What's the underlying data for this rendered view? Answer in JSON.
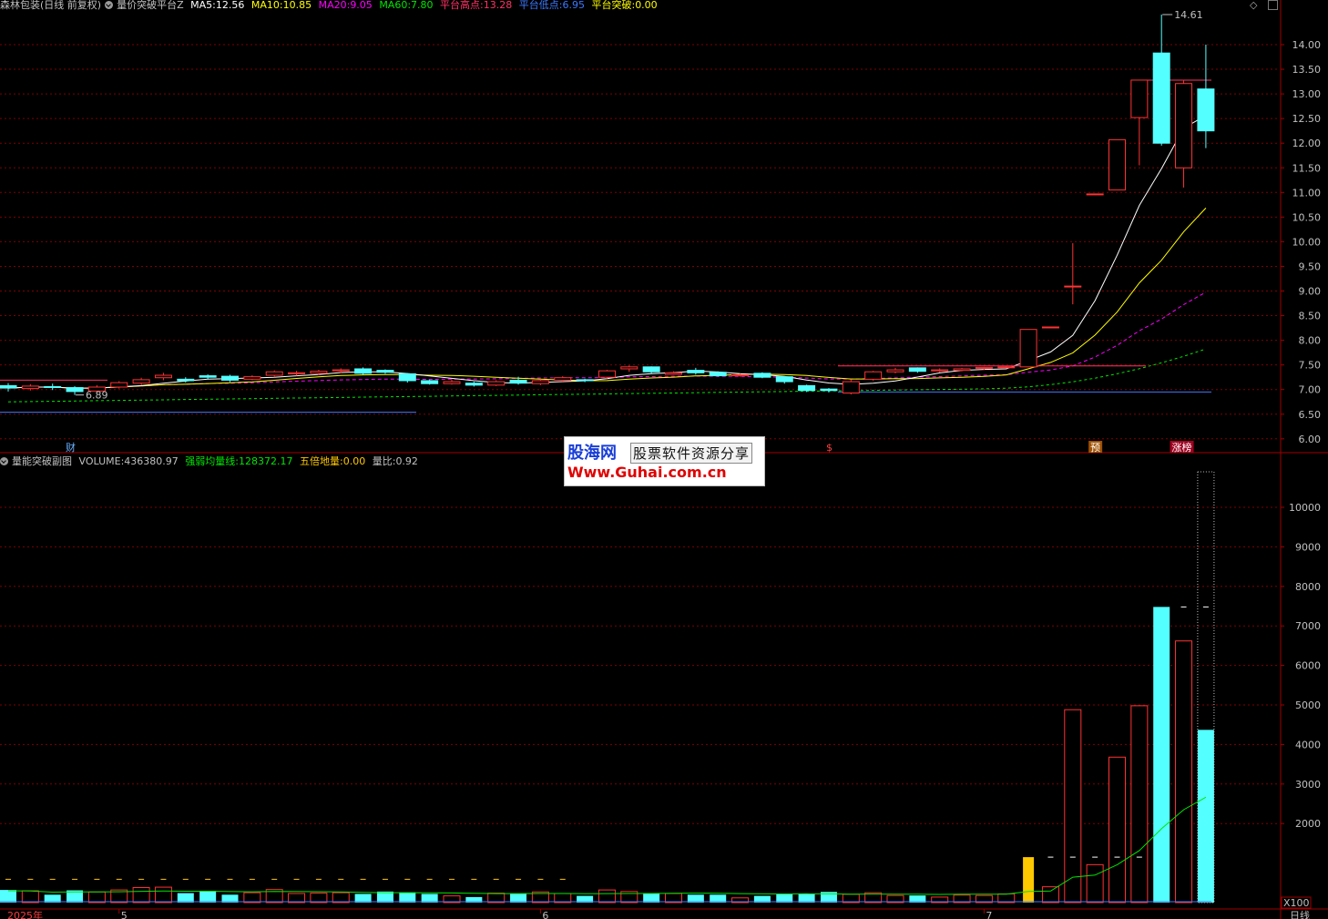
{
  "header": {
    "stock": "森林包装(日线 前复权)",
    "indicator": "量价突破平台Z",
    "ma5_label": "MA5:",
    "ma5": "12.56",
    "ma10_label": "MA10:",
    "ma10": "10.85",
    "ma20_label": "MA20:",
    "ma20": "9.05",
    "ma60_label": "MA60:",
    "ma60": "7.80",
    "high_label": "平台高点:",
    "high": "13.28",
    "low_label": "平台低点:",
    "low": "6.95",
    "break_label": "平台突破:",
    "break": "0.00"
  },
  "sub": {
    "indicator": "量能突破副图",
    "vol_label": "VOLUME:",
    "vol": "436380.97",
    "avg_label": "强弱均量线:",
    "avg": "128372.17",
    "five_label": "五倍地量:",
    "five": "0.00",
    "ratio_label": "量比:",
    "ratio": "0.92"
  },
  "price_axis": [
    "14.00",
    "13.50",
    "13.00",
    "12.50",
    "12.00",
    "11.50",
    "11.00",
    "10.50",
    "10.00",
    "9.50",
    "9.00",
    "8.50",
    "8.00",
    "7.50",
    "7.00",
    "6.50",
    "6.00"
  ],
  "vol_axis": [
    "10000",
    "9000",
    "8000",
    "7000",
    "6000",
    "5000",
    "4000",
    "3000",
    "2000"
  ],
  "vol_unit": "X100",
  "annotations": {
    "max_price": "14.61",
    "min_price": "6.89",
    "marker_cai": "财",
    "marker_s": "$",
    "marker_yu": "预",
    "marker_zhang": "涨榜"
  },
  "date_axis": {
    "year": "2025年",
    "m5": "5",
    "m6": "6",
    "m7": "7",
    "period": "日线"
  },
  "watermark": {
    "name": "股海网",
    "slogan": "股票软件资源分享",
    "url": "Www.Guhai.com.cn"
  },
  "colors": {
    "up": "#ff3232",
    "down": "#54ffff",
    "ma5": "#ffffff",
    "ma10": "#ffff00",
    "ma20": "#ff00ff",
    "ma60": "#00e600",
    "platform_high": "#ff3264",
    "platform_low": "#3c78ff",
    "grid": "#800000"
  },
  "chart_data": {
    "type": "candlestick",
    "price_ylim": [
      5.9,
      14.75
    ],
    "volume_ylim": [
      0,
      11000
    ],
    "candles": [
      [
        7.08,
        7.03,
        7.13,
        6.96,
        320
      ],
      [
        7.02,
        7.07,
        7.11,
        6.98,
        300
      ],
      [
        7.06,
        7.05,
        7.12,
        6.99,
        200
      ],
      [
        7.04,
        6.96,
        7.07,
        6.89,
        310
      ],
      [
        6.97,
        7.05,
        7.09,
        6.94,
        270
      ],
      [
        7.05,
        7.14,
        7.17,
        7.02,
        320
      ],
      [
        7.13,
        7.2,
        7.24,
        7.09,
        380
      ],
      [
        7.24,
        7.29,
        7.34,
        7.19,
        390
      ],
      [
        7.21,
        7.18,
        7.25,
        7.14,
        240
      ],
      [
        7.28,
        7.25,
        7.31,
        7.2,
        300
      ],
      [
        7.27,
        7.19,
        7.3,
        7.15,
        200
      ],
      [
        7.21,
        7.26,
        7.29,
        7.19,
        250
      ],
      [
        7.29,
        7.36,
        7.39,
        7.25,
        330
      ],
      [
        7.32,
        7.34,
        7.38,
        7.28,
        230
      ],
      [
        7.33,
        7.37,
        7.4,
        7.29,
        240
      ],
      [
        7.38,
        7.4,
        7.43,
        7.33,
        250
      ],
      [
        7.42,
        7.33,
        7.45,
        7.3,
        220
      ],
      [
        7.39,
        7.35,
        7.41,
        7.32,
        280
      ],
      [
        7.32,
        7.18,
        7.33,
        7.14,
        260
      ],
      [
        7.18,
        7.12,
        7.2,
        7.1,
        220
      ],
      [
        7.12,
        7.16,
        7.2,
        7.1,
        170
      ],
      [
        7.13,
        7.09,
        7.16,
        7.06,
        140
      ],
      [
        7.09,
        7.16,
        7.19,
        7.07,
        240
      ],
      [
        7.19,
        7.13,
        7.26,
        7.1,
        230
      ],
      [
        7.12,
        7.18,
        7.21,
        7.09,
        270
      ],
      [
        7.19,
        7.24,
        7.27,
        7.16,
        230
      ],
      [
        7.2,
        7.18,
        7.22,
        7.15,
        170
      ],
      [
        7.25,
        7.38,
        7.4,
        7.22,
        320
      ],
      [
        7.42,
        7.46,
        7.49,
        7.36,
        280
      ],
      [
        7.46,
        7.36,
        7.47,
        7.33,
        230
      ],
      [
        7.31,
        7.34,
        7.37,
        7.3,
        230
      ],
      [
        7.39,
        7.34,
        7.44,
        7.3,
        200
      ],
      [
        7.35,
        7.28,
        7.37,
        7.26,
        200
      ],
      [
        7.28,
        7.3,
        7.32,
        7.26,
        120
      ],
      [
        7.33,
        7.25,
        7.35,
        7.23,
        170
      ],
      [
        7.26,
        7.16,
        7.27,
        7.12,
        210
      ],
      [
        7.08,
        6.98,
        7.1,
        6.95,
        230
      ],
      [
        7.01,
        6.98,
        7.03,
        6.94,
        270
      ],
      [
        6.93,
        7.16,
        7.2,
        6.9,
        210
      ],
      [
        7.21,
        7.36,
        7.38,
        7.18,
        250
      ],
      [
        7.36,
        7.4,
        7.44,
        7.33,
        180
      ],
      [
        7.44,
        7.37,
        7.45,
        7.34,
        180
      ],
      [
        7.38,
        7.4,
        7.43,
        7.35,
        140
      ],
      [
        7.39,
        7.42,
        7.44,
        7.37,
        190
      ],
      [
        7.43,
        7.45,
        7.46,
        7.4,
        180
      ],
      [
        7.46,
        7.46,
        7.48,
        7.43,
        220
      ],
      [
        7.46,
        8.22,
        8.22,
        7.46,
        1150
      ],
      [
        8.27,
        8.27,
        8.27,
        8.27,
        400
      ],
      [
        9.1,
        9.1,
        9.97,
        8.73,
        4880
      ],
      [
        10.97,
        10.97,
        10.97,
        10.97,
        960
      ],
      [
        11.05,
        12.07,
        12.07,
        11.05,
        3680
      ],
      [
        12.52,
        13.28,
        13.28,
        11.55,
        4980
      ],
      [
        13.83,
        12.0,
        14.61,
        11.95,
        7480
      ],
      [
        11.5,
        13.21,
        13.28,
        11.1,
        6620
      ],
      [
        13.1,
        12.25,
        14.0,
        11.9,
        4370
      ]
    ]
  }
}
